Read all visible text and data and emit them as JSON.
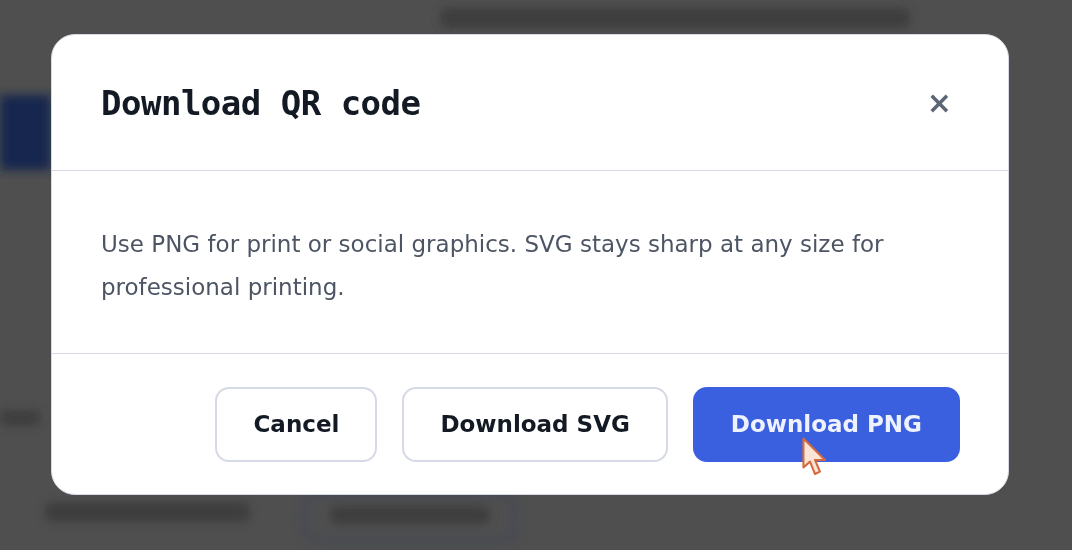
{
  "dialog": {
    "title": "Download QR code",
    "close": "×",
    "message": "Use PNG for print or social graphics. SVG stays sharp at any size for professional printing.",
    "buttons": [
      {
        "label": "Cancel",
        "kind": "secondary"
      },
      {
        "label": "Download SVG",
        "kind": "secondary"
      },
      {
        "label": "Download PNG",
        "kind": "primary",
        "hovered": true
      }
    ]
  }
}
